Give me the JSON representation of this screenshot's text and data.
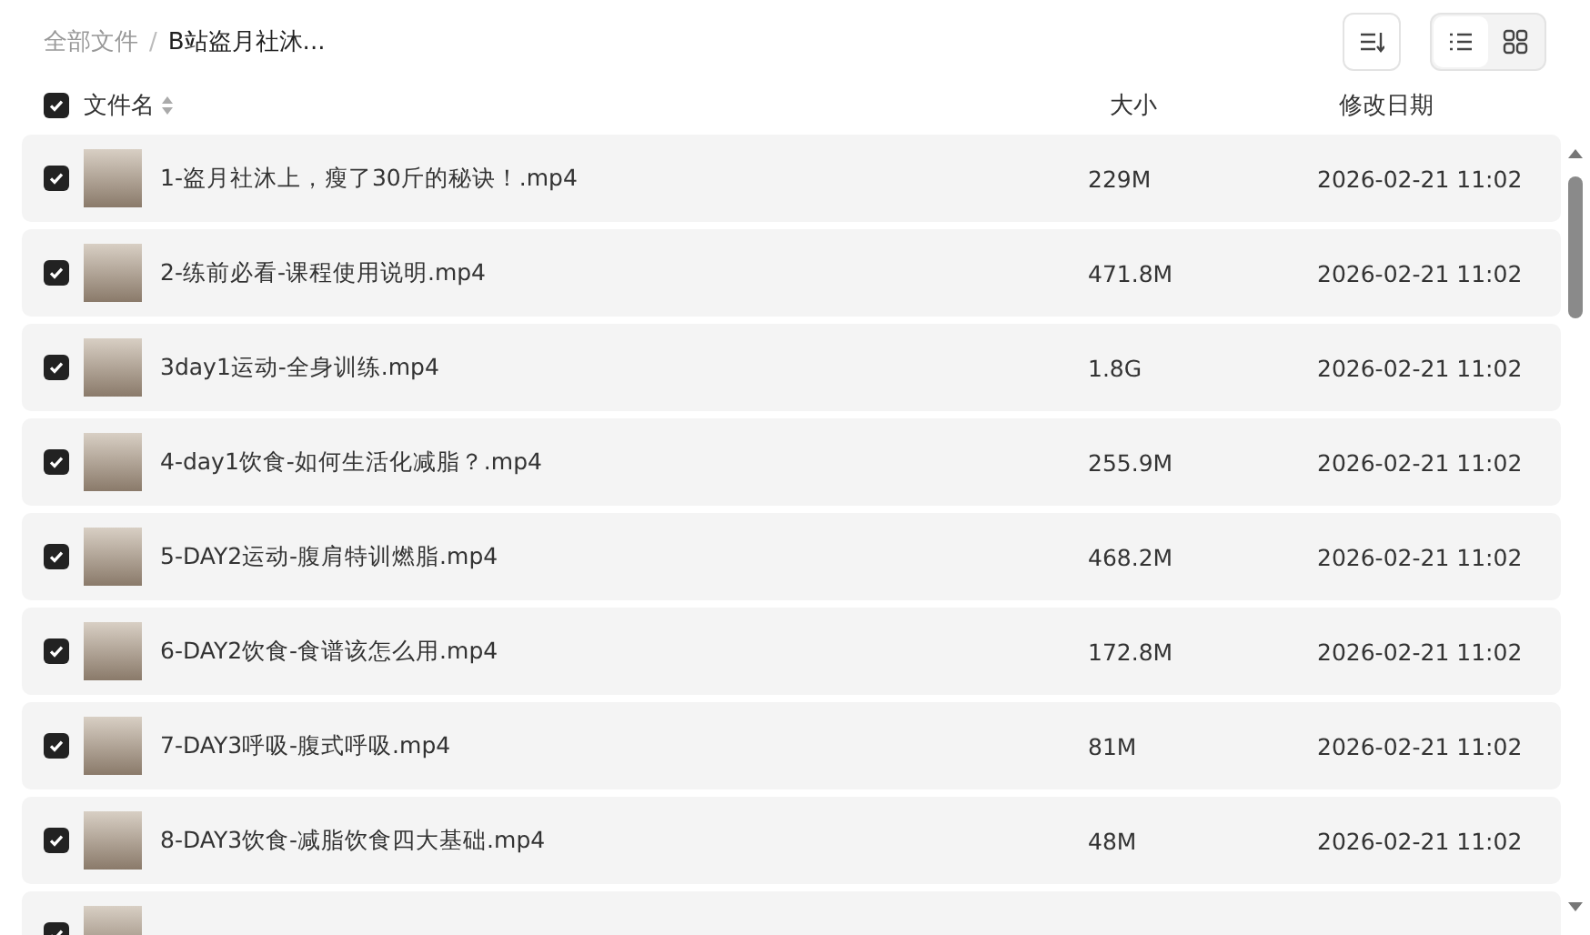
{
  "breadcrumb_separator": "/",
  "breadcrumb": [
    {
      "label": "全部文件",
      "current": false
    },
    {
      "label": "B站盗月社沐...",
      "current": true
    }
  ],
  "view_toggle": [
    {
      "kind": "list",
      "selected": true
    },
    {
      "kind": "grid",
      "selected": false
    }
  ],
  "table": {
    "all_checked": true,
    "columns": [
      "文件名",
      "大小",
      "修改日期"
    ],
    "rows": [
      {
        "checked": true,
        "name": "1-盗月社沐上，瘦了30斤的秘诀！.mp4",
        "size": "229M",
        "modified": "2026-02-21 11:02"
      },
      {
        "checked": true,
        "name": "2-练前必看-课程使用说明.mp4",
        "size": "471.8M",
        "modified": "2026-02-21 11:02"
      },
      {
        "checked": true,
        "name": "3day1运动-全身训练.mp4",
        "size": "1.8G",
        "modified": "2026-02-21 11:02"
      },
      {
        "checked": true,
        "name": "4-day1饮食-如何生活化减脂？.mp4",
        "size": "255.9M",
        "modified": "2026-02-21 11:02"
      },
      {
        "checked": true,
        "name": "5-DAY2运动-腹肩特训燃脂.mp4",
        "size": "468.2M",
        "modified": "2026-02-21 11:02"
      },
      {
        "checked": true,
        "name": "6-DAY2饮食-食谱该怎么用.mp4",
        "size": "172.8M",
        "modified": "2026-02-21 11:02"
      },
      {
        "checked": true,
        "name": "7-DAY3呼吸-腹式呼吸.mp4",
        "size": "81M",
        "modified": "2026-02-21 11:02"
      },
      {
        "checked": true,
        "name": "8-DAY3饮食-减脂饮食四大基础.mp4",
        "size": "48M",
        "modified": "2026-02-21 11:02"
      },
      {
        "checked": true
      }
    ]
  }
}
